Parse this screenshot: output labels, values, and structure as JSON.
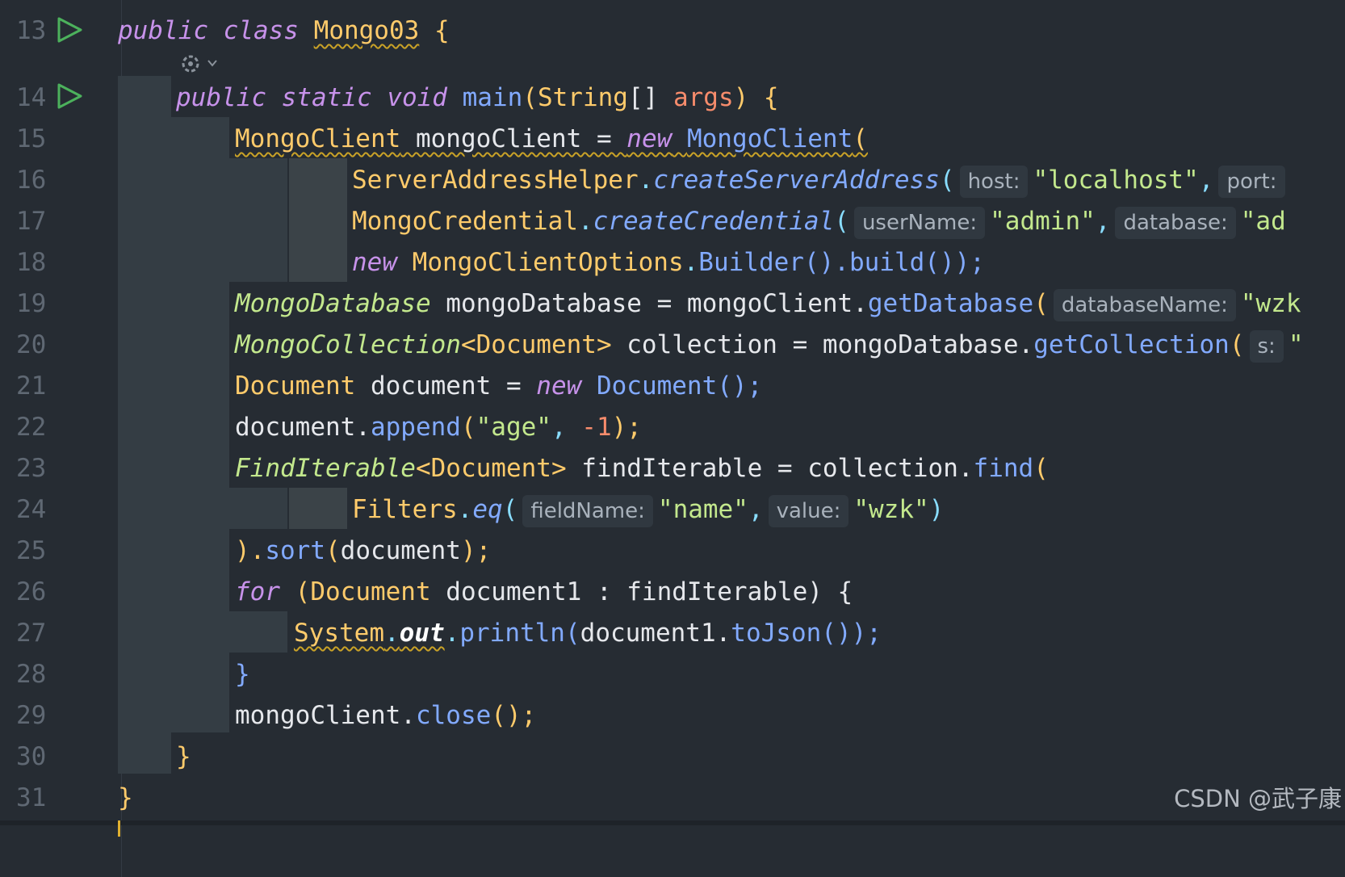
{
  "editor": {
    "line_numbers": [
      "13",
      "14",
      "15",
      "16",
      "17",
      "18",
      "19",
      "20",
      "21",
      "22",
      "23",
      "24",
      "25",
      "26",
      "27",
      "28",
      "29",
      "30",
      "31"
    ],
    "code": {
      "l13": {
        "a": "public",
        "b": " ",
        "c": "class",
        "d": " ",
        "e": "Mongo03",
        "f": " {"
      },
      "l14": {
        "a": "public",
        "b": " ",
        "c": "static",
        "d": " ",
        "e": "void",
        "f": " ",
        "g": "main",
        "h": "(",
        "i": "String",
        "j": "[] ",
        "k": "args",
        "l": ") {"
      },
      "l15": {
        "a": "MongoClient",
        "b": " mongoClient = ",
        "c": "new",
        "d": " ",
        "e": "MongoClient",
        "f": "("
      },
      "l16": {
        "a": "ServerAddressHelper",
        "b": ".",
        "c": "createServerAddress",
        "d": "(",
        "hint1": "host:",
        "e": "\"localhost\"",
        "f": ",",
        "hint2": "port:"
      },
      "l17": {
        "a": "MongoCredential",
        "b": ".",
        "c": "createCredential",
        "d": "(",
        "hint1": "userName:",
        "e": "\"admin\"",
        "f": ",",
        "hint2": "database:",
        "g": "\"ad"
      },
      "l18": {
        "a": "new",
        "b": " ",
        "c": "MongoClientOptions",
        "d": ".",
        "e": "Builder",
        "f": "().",
        "g": "build",
        "h": "());"
      },
      "l19": {
        "a": "MongoDatabase",
        "b": " mongoDatabase = mongoClient.",
        "c": "getDatabase",
        "d": "(",
        "hint1": "databaseName:",
        "e": "\"wzk"
      },
      "l20": {
        "a": "MongoCollection",
        "b": "<Document>",
        "c": " collection = mongoDatabase.",
        "d": "getCollection",
        "e": "(",
        "hint1": "s:",
        "f": "\""
      },
      "l21": {
        "a": "Document",
        "b": " document = ",
        "c": "new",
        "d": " ",
        "e": "Document",
        "f": "();"
      },
      "l22": {
        "a": "document.",
        "b": "append",
        "c": "(",
        "d": "\"age\"",
        "e": ", ",
        "f": "-1",
        "g": ");"
      },
      "l23": {
        "a": "FindIterable",
        "b": "<Document>",
        "c": " findIterable = collection.",
        "d": "find",
        "e": "("
      },
      "l24": {
        "a": "Filters",
        "b": ".",
        "c": "eq",
        "d": "(",
        "hint1": "fieldName:",
        "e": "\"name\"",
        "f": ",",
        "hint2": "value:",
        "g": "\"wzk\"",
        "h": ")"
      },
      "l25": {
        "a": ").",
        "b": "sort",
        "c": "(",
        "d": "document",
        "e": ");"
      },
      "l26": {
        "a": "for",
        "b": " (",
        "c": "Document",
        "d": " document1 : findIterable) {"
      },
      "l27": {
        "a": "System",
        "b": ".",
        "c": "out",
        "d": ".",
        "e": "println",
        "f": "(",
        "g": "document1.",
        "h": "toJson",
        "i": "());"
      },
      "l28": {
        "a": "}"
      },
      "l29": {
        "a": "mongoClient.",
        "b": "close",
        "c": "();"
      },
      "l30": {
        "a": "}"
      },
      "l31": {
        "a": "}"
      }
    }
  },
  "watermark": "CSDN @武子康",
  "icons": {
    "run": "run-play-icon",
    "ai": "ai-assistant-icon",
    "chevron": "chevron-down-icon"
  },
  "colors": {
    "background": "#262c33",
    "keyword": "#c792ea",
    "type": "#ffcb6b",
    "function": "#82aaff",
    "string": "#c3e88d",
    "number": "#f78c6c"
  }
}
